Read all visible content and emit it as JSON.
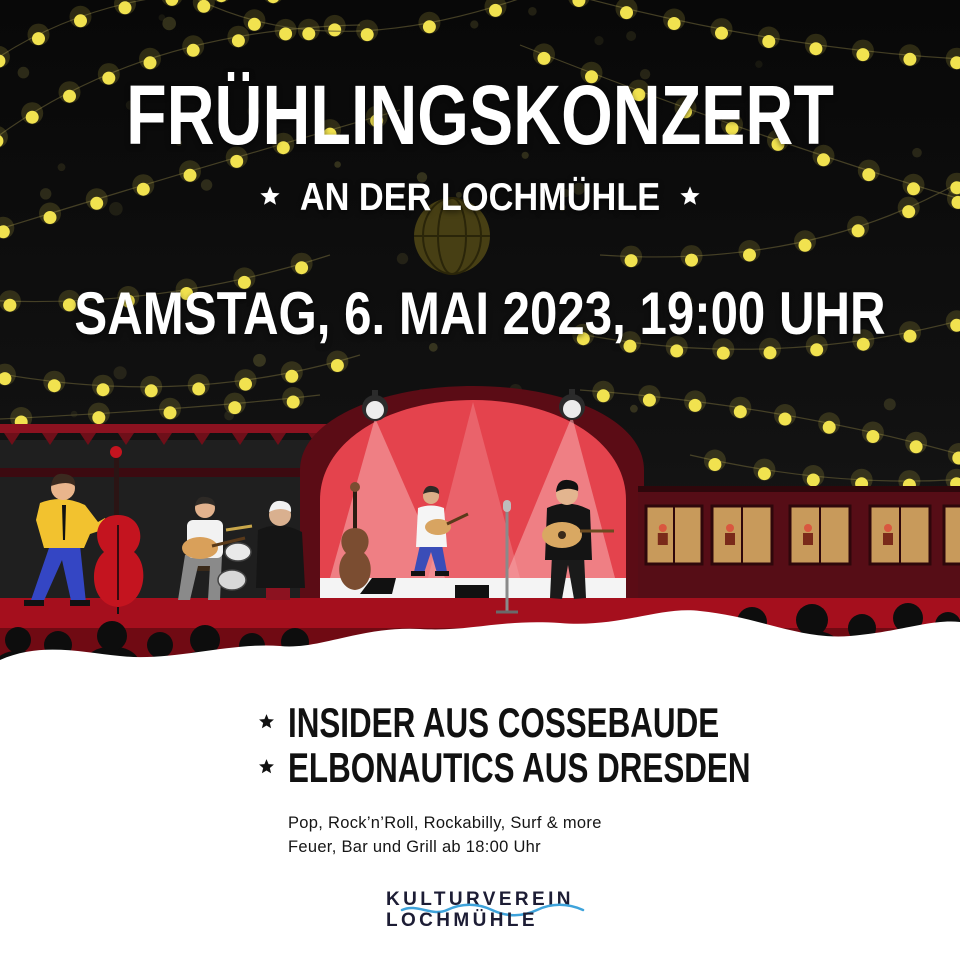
{
  "poster": {
    "title": "FRÜHLINGSKONZERT",
    "subtitle": "AN DER LOCHMÜHLE",
    "date_line": "SAMSTAG, 6. MAI 2023, 19:00 UHR"
  },
  "lineup": {
    "acts": [
      {
        "label": "INSIDER AUS COSSEBAUDE"
      },
      {
        "label": "ELBONAUTICS AUS DRESDEN"
      }
    ],
    "genres": "Pop, Rock’n’Roll, Rockabilly, Surf & more",
    "extras": "Feuer, Bar und Grill ab 18:00 Uhr"
  },
  "logo": {
    "line1": "KULTURVEREIN",
    "line2": "LOCHMÜHLE"
  },
  "icons": {
    "subtitle_decoration": "star-icon",
    "list_bullet": "star-icon"
  },
  "colors": {
    "night_sky": "#0c0c0c",
    "light_bulb": "#f1e24f",
    "stage_red": "#e4434d",
    "headline_text": "#ffffff",
    "body_text": "#111111",
    "logo_text": "#1d1d35",
    "logo_wave": "#3ea3db"
  }
}
